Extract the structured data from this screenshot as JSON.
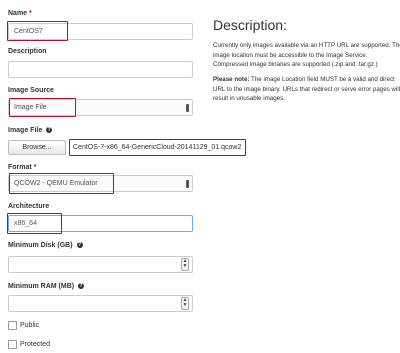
{
  "form": {
    "name": {
      "label": "Name",
      "required": "*",
      "value": "CentOS7"
    },
    "description": {
      "label": "Description",
      "value": ""
    },
    "image_source": {
      "label": "Image Source",
      "value": "Image File"
    },
    "image_file": {
      "label": "Image File",
      "button": "Browse...",
      "filename": "CentOS-7-x86_64-GenericCloud-20141129_01.qcow2"
    },
    "format": {
      "label": "Format",
      "required": "*",
      "value": "QCOW2 - QEMU Emulator"
    },
    "architecture": {
      "label": "Architecture",
      "value": "x86_64"
    },
    "min_disk": {
      "label": "Minimum Disk (GB)",
      "value": ""
    },
    "min_ram": {
      "label": "Minimum RAM (MB)",
      "value": ""
    },
    "public": {
      "label": "Public",
      "checked": false
    },
    "protected": {
      "label": "Protected",
      "checked": false
    }
  },
  "help_icon": "?",
  "spinner": {
    "up": "▲",
    "down": "▼"
  },
  "description_panel": {
    "title": "Description:",
    "para1": "Currently only images available via an HTTP URL are supported. The image location must be accessible to the Image Service. Compressed image binaries are supported (.zip and .tar.gz.)",
    "note_label": "Please note:",
    "note_text": " The image Location field MUST be a valid and direct URL to the image binary. URLs that redirect or serve error pages will result in unusable images."
  },
  "colors": {
    "highlight": "#b0112a",
    "focus_border": "#66afe9"
  }
}
